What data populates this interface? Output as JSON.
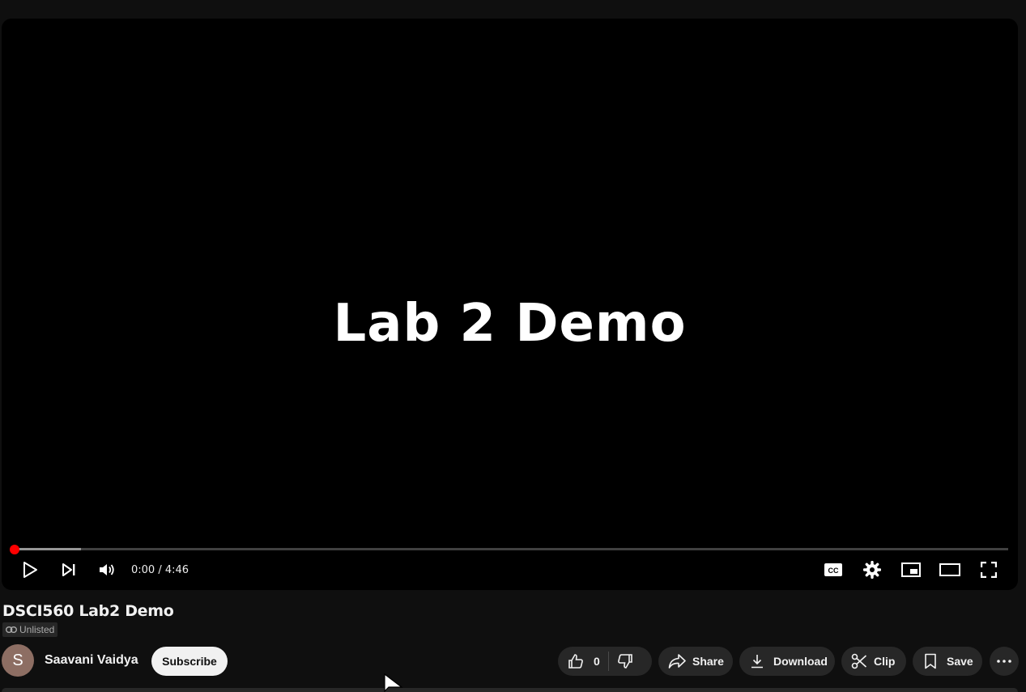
{
  "player": {
    "screen_text": "Lab 2 Demo",
    "time_display": "0:00 / 4:46",
    "progress_loaded": 0.068,
    "progress_played": 0.0,
    "controls": [
      "play-icon",
      "next-icon",
      "volume-icon",
      "subtitles-icon",
      "settings-icon",
      "miniplayer-icon",
      "theater-icon",
      "fullscreen-icon"
    ]
  },
  "video": {
    "title": "DSCI560 Lab2 Demo",
    "visibility": "Unlisted"
  },
  "channel": {
    "avatar_letter": "S",
    "name": "Saavani Vaidya",
    "subscribe_label": "Subscribe"
  },
  "actions": {
    "like_count": "0",
    "share_label": "Share",
    "download_label": "Download",
    "clip_label": "Clip",
    "save_label": "Save"
  },
  "colors": {
    "background": "#0f0f0f",
    "accent": "#ff0000",
    "pill": "#272727"
  }
}
